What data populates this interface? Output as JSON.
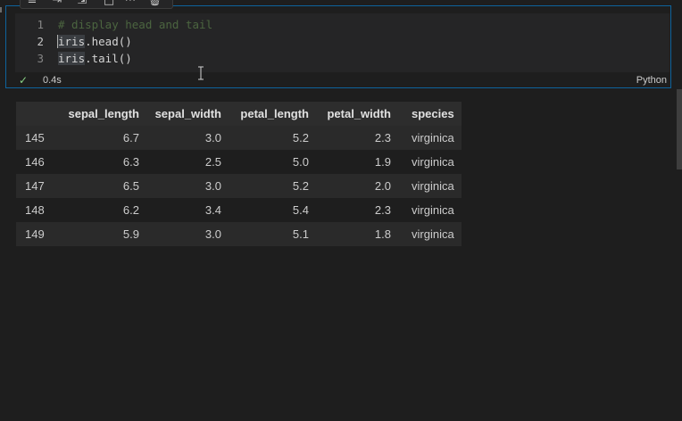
{
  "toolbar": {
    "icons": [
      "execute-above-icon",
      "execute-below-icon",
      "split-cell-icon",
      "more-icon",
      "delete-icon"
    ]
  },
  "cell": {
    "lines": [
      {
        "number": "1",
        "text": "# display head and tail"
      },
      {
        "number": "2",
        "prefix": "iris",
        "suffix": ".head()"
      },
      {
        "number": "3",
        "prefix": "iris",
        "suffix": ".tail()"
      }
    ],
    "exec_time": "0.4s",
    "language": "Python",
    "status": "success"
  },
  "output_table": {
    "columns": [
      "",
      "sepal_length",
      "sepal_width",
      "petal_length",
      "petal_width",
      "species"
    ],
    "rows": [
      [
        "145",
        "6.7",
        "3.0",
        "5.2",
        "2.3",
        "virginica"
      ],
      [
        "146",
        "6.3",
        "2.5",
        "5.0",
        "1.9",
        "virginica"
      ],
      [
        "147",
        "6.5",
        "3.0",
        "5.2",
        "2.0",
        "virginica"
      ],
      [
        "148",
        "6.2",
        "3.4",
        "5.4",
        "2.3",
        "virginica"
      ],
      [
        "149",
        "5.9",
        "3.0",
        "5.1",
        "1.8",
        "virginica"
      ]
    ]
  },
  "colors": {
    "background": "#1e1e1e",
    "cell_border": "#0e639c",
    "editor_bg": "#252526",
    "success": "#89d185"
  }
}
